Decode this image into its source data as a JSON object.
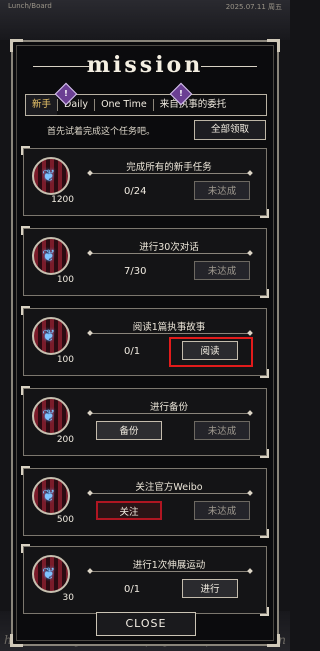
{
  "background": {
    "top_text_left": "Lunch/Board",
    "top_text_right": "2025.07.11 周五",
    "bottom_nav": [
      "home",
      "story",
      "closet",
      "play",
      "shop",
      "collection"
    ]
  },
  "panel": {
    "title": "mission"
  },
  "tabs": [
    {
      "label": "新手",
      "active": true
    },
    {
      "label": "Daily",
      "active": false
    },
    {
      "label": "One Time",
      "active": false
    },
    {
      "label": "来自执事的委托",
      "active": false
    }
  ],
  "tab_badges": [
    "!",
    "!"
  ],
  "hint": "首先试着完成这个任务吧。",
  "claim_all": "全部领取",
  "missions": [
    {
      "title": "完成所有的新手任务",
      "reward": "1200",
      "progress": "0/24",
      "button": "未达成",
      "state": "incomplete",
      "btn_side": "right"
    },
    {
      "title": "进行30次对话",
      "reward": "100",
      "progress": "7/30",
      "button": "未达成",
      "state": "incomplete",
      "btn_side": "right"
    },
    {
      "title": "阅读1篇执事故事",
      "reward": "100",
      "progress": "0/1",
      "button": "阅读",
      "state": "go",
      "btn_side": "right",
      "highlighted": true
    },
    {
      "title": "进行备份",
      "reward": "200",
      "progress": "",
      "button_left": "备份",
      "button": "未达成",
      "state": "incomplete",
      "btn_side": "both"
    },
    {
      "title": "关注官方Weibo",
      "reward": "500",
      "progress": "",
      "button_left": "关注",
      "button": "未达成",
      "state": "incomplete",
      "btn_side": "both",
      "follow": true
    },
    {
      "title": "进行1次伸展运动",
      "reward": "30",
      "progress": "0/1",
      "button": "进行",
      "state": "go",
      "btn_side": "right"
    }
  ],
  "close": "CLOSE",
  "colors": {
    "accent_gold": "#e9c46a",
    "highlight_red": "#e21b1b",
    "badge_purple": "#6b3f93",
    "reward_crimson": "#7a1c2a"
  }
}
